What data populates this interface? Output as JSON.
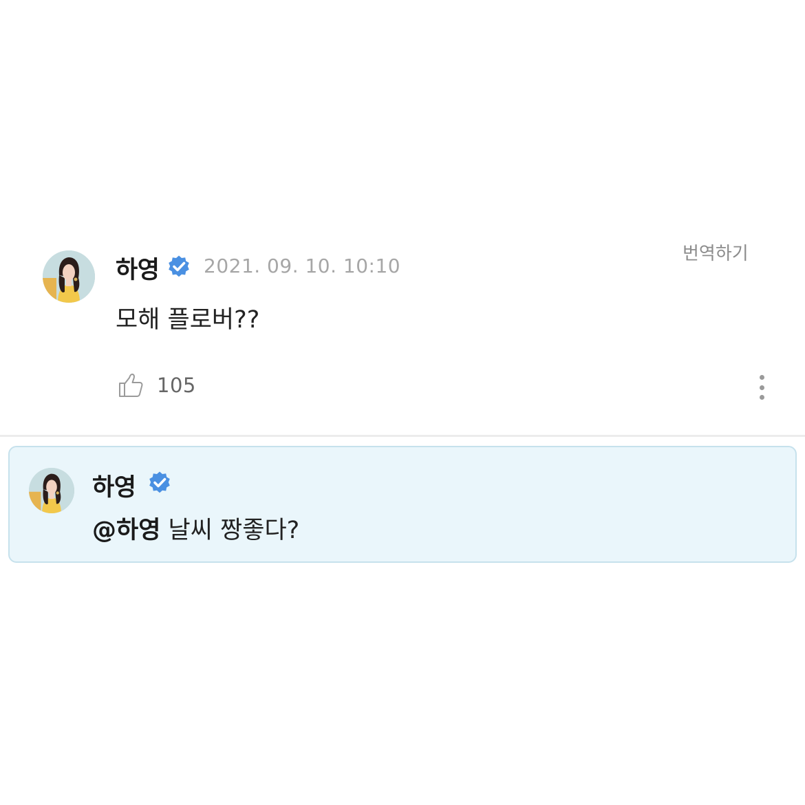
{
  "comment": {
    "author": "하영",
    "timestamp": "2021. 09. 10. 10:10",
    "translate_label": "번역하기",
    "text": "모해 플로버??",
    "like_count": "105"
  },
  "reply": {
    "author": "하영",
    "mention": "@하영",
    "text": " 날씨 짱좋다?"
  },
  "colors": {
    "verified": "#4a90e2",
    "reply_background": "#eaf6fb",
    "reply_border": "#c6e1ec"
  },
  "icons": {
    "verified": "verified-badge-icon",
    "like": "thumbs-up-icon",
    "more": "more-vertical-icon"
  }
}
